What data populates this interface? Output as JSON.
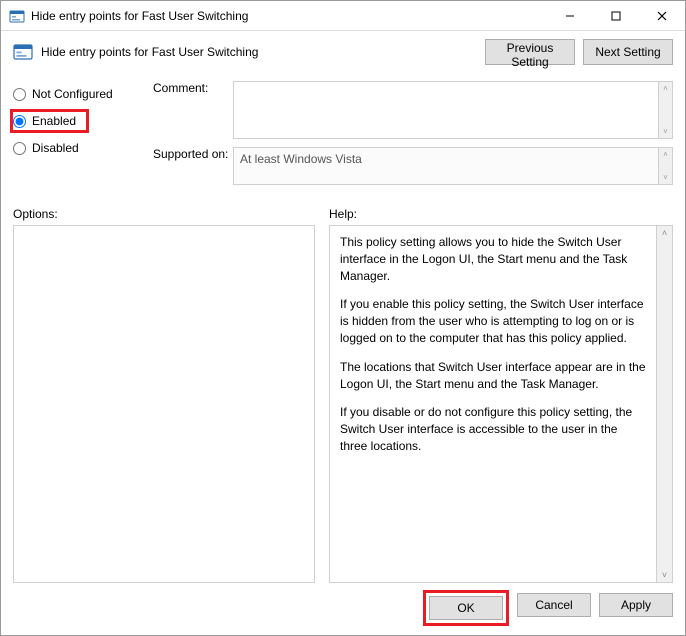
{
  "window": {
    "title": "Hide entry points for Fast User Switching",
    "subheader": "Hide entry points for Fast User Switching"
  },
  "nav": {
    "previous": "Previous Setting",
    "next": "Next Setting"
  },
  "state": {
    "not_configured": "Not Configured",
    "enabled": "Enabled",
    "disabled": "Disabled",
    "selected": "enabled"
  },
  "labels": {
    "comment": "Comment:",
    "supported_on": "Supported on:",
    "options": "Options:",
    "help": "Help:"
  },
  "fields": {
    "comment_value": "",
    "supported_on_value": "At least Windows Vista"
  },
  "help_text": {
    "p1": "This policy setting allows you to hide the Switch User interface in the Logon UI, the Start menu and the Task Manager.",
    "p2": "If you enable this policy setting, the Switch User interface is hidden from the user who is attempting to log on or is logged on to the computer that has this policy applied.",
    "p3": "The locations that Switch User interface appear are in the Logon UI, the Start menu and the Task Manager.",
    "p4": "If you disable or do not configure this policy setting, the Switch User interface is accessible to the user in the three locations."
  },
  "buttons": {
    "ok": "OK",
    "cancel": "Cancel",
    "apply": "Apply"
  }
}
